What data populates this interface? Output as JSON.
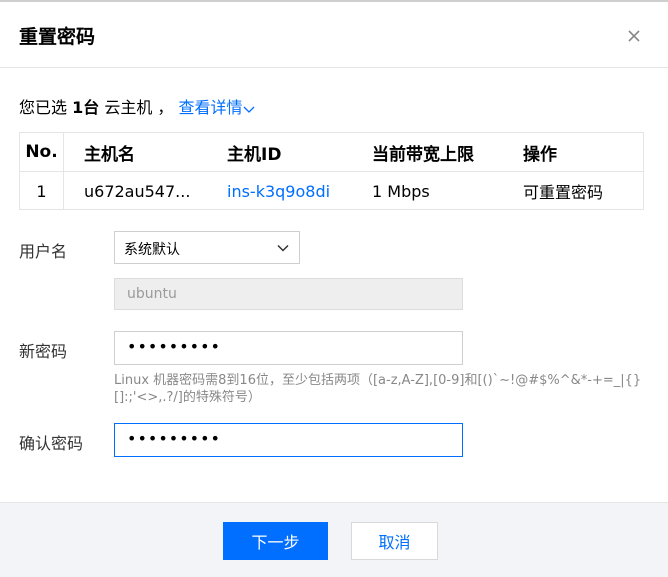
{
  "dialog": {
    "title": "重置密码",
    "close_icon": "close-icon"
  },
  "selection": {
    "prefix": "您已选",
    "count": "1台",
    "suffix": "云主机 ，",
    "detail_link": "查看详情",
    "detail_icon": "chevron-down-icon"
  },
  "table": {
    "headers": [
      "No.",
      "主机名",
      "主机ID",
      "当前带宽上限",
      "操作"
    ],
    "rows": [
      [
        "1",
        "u672au547...",
        "ins-k3q9o8di",
        "1 Mbps",
        "可重置密码"
      ]
    ]
  },
  "form": {
    "username_label": "用户名",
    "username_select_value": "系统默认",
    "username_value": "ubuntu",
    "new_password_label": "新密码",
    "new_password_value": "•••••••••",
    "password_hint": "Linux 机器密码需8到16位，至少包括两项（[a-z,A-Z],[0-9]和[()`~!@#$%^&*-+=_|{}[]:;'<>,.?/]的特殊符号）",
    "confirm_password_label": "确认密码",
    "confirm_password_value": "•••••••••"
  },
  "footer": {
    "next_label": "下一步",
    "cancel_label": "取消"
  },
  "colors": {
    "accent": "#006eff",
    "footer_bg": "#f2f4f7"
  }
}
